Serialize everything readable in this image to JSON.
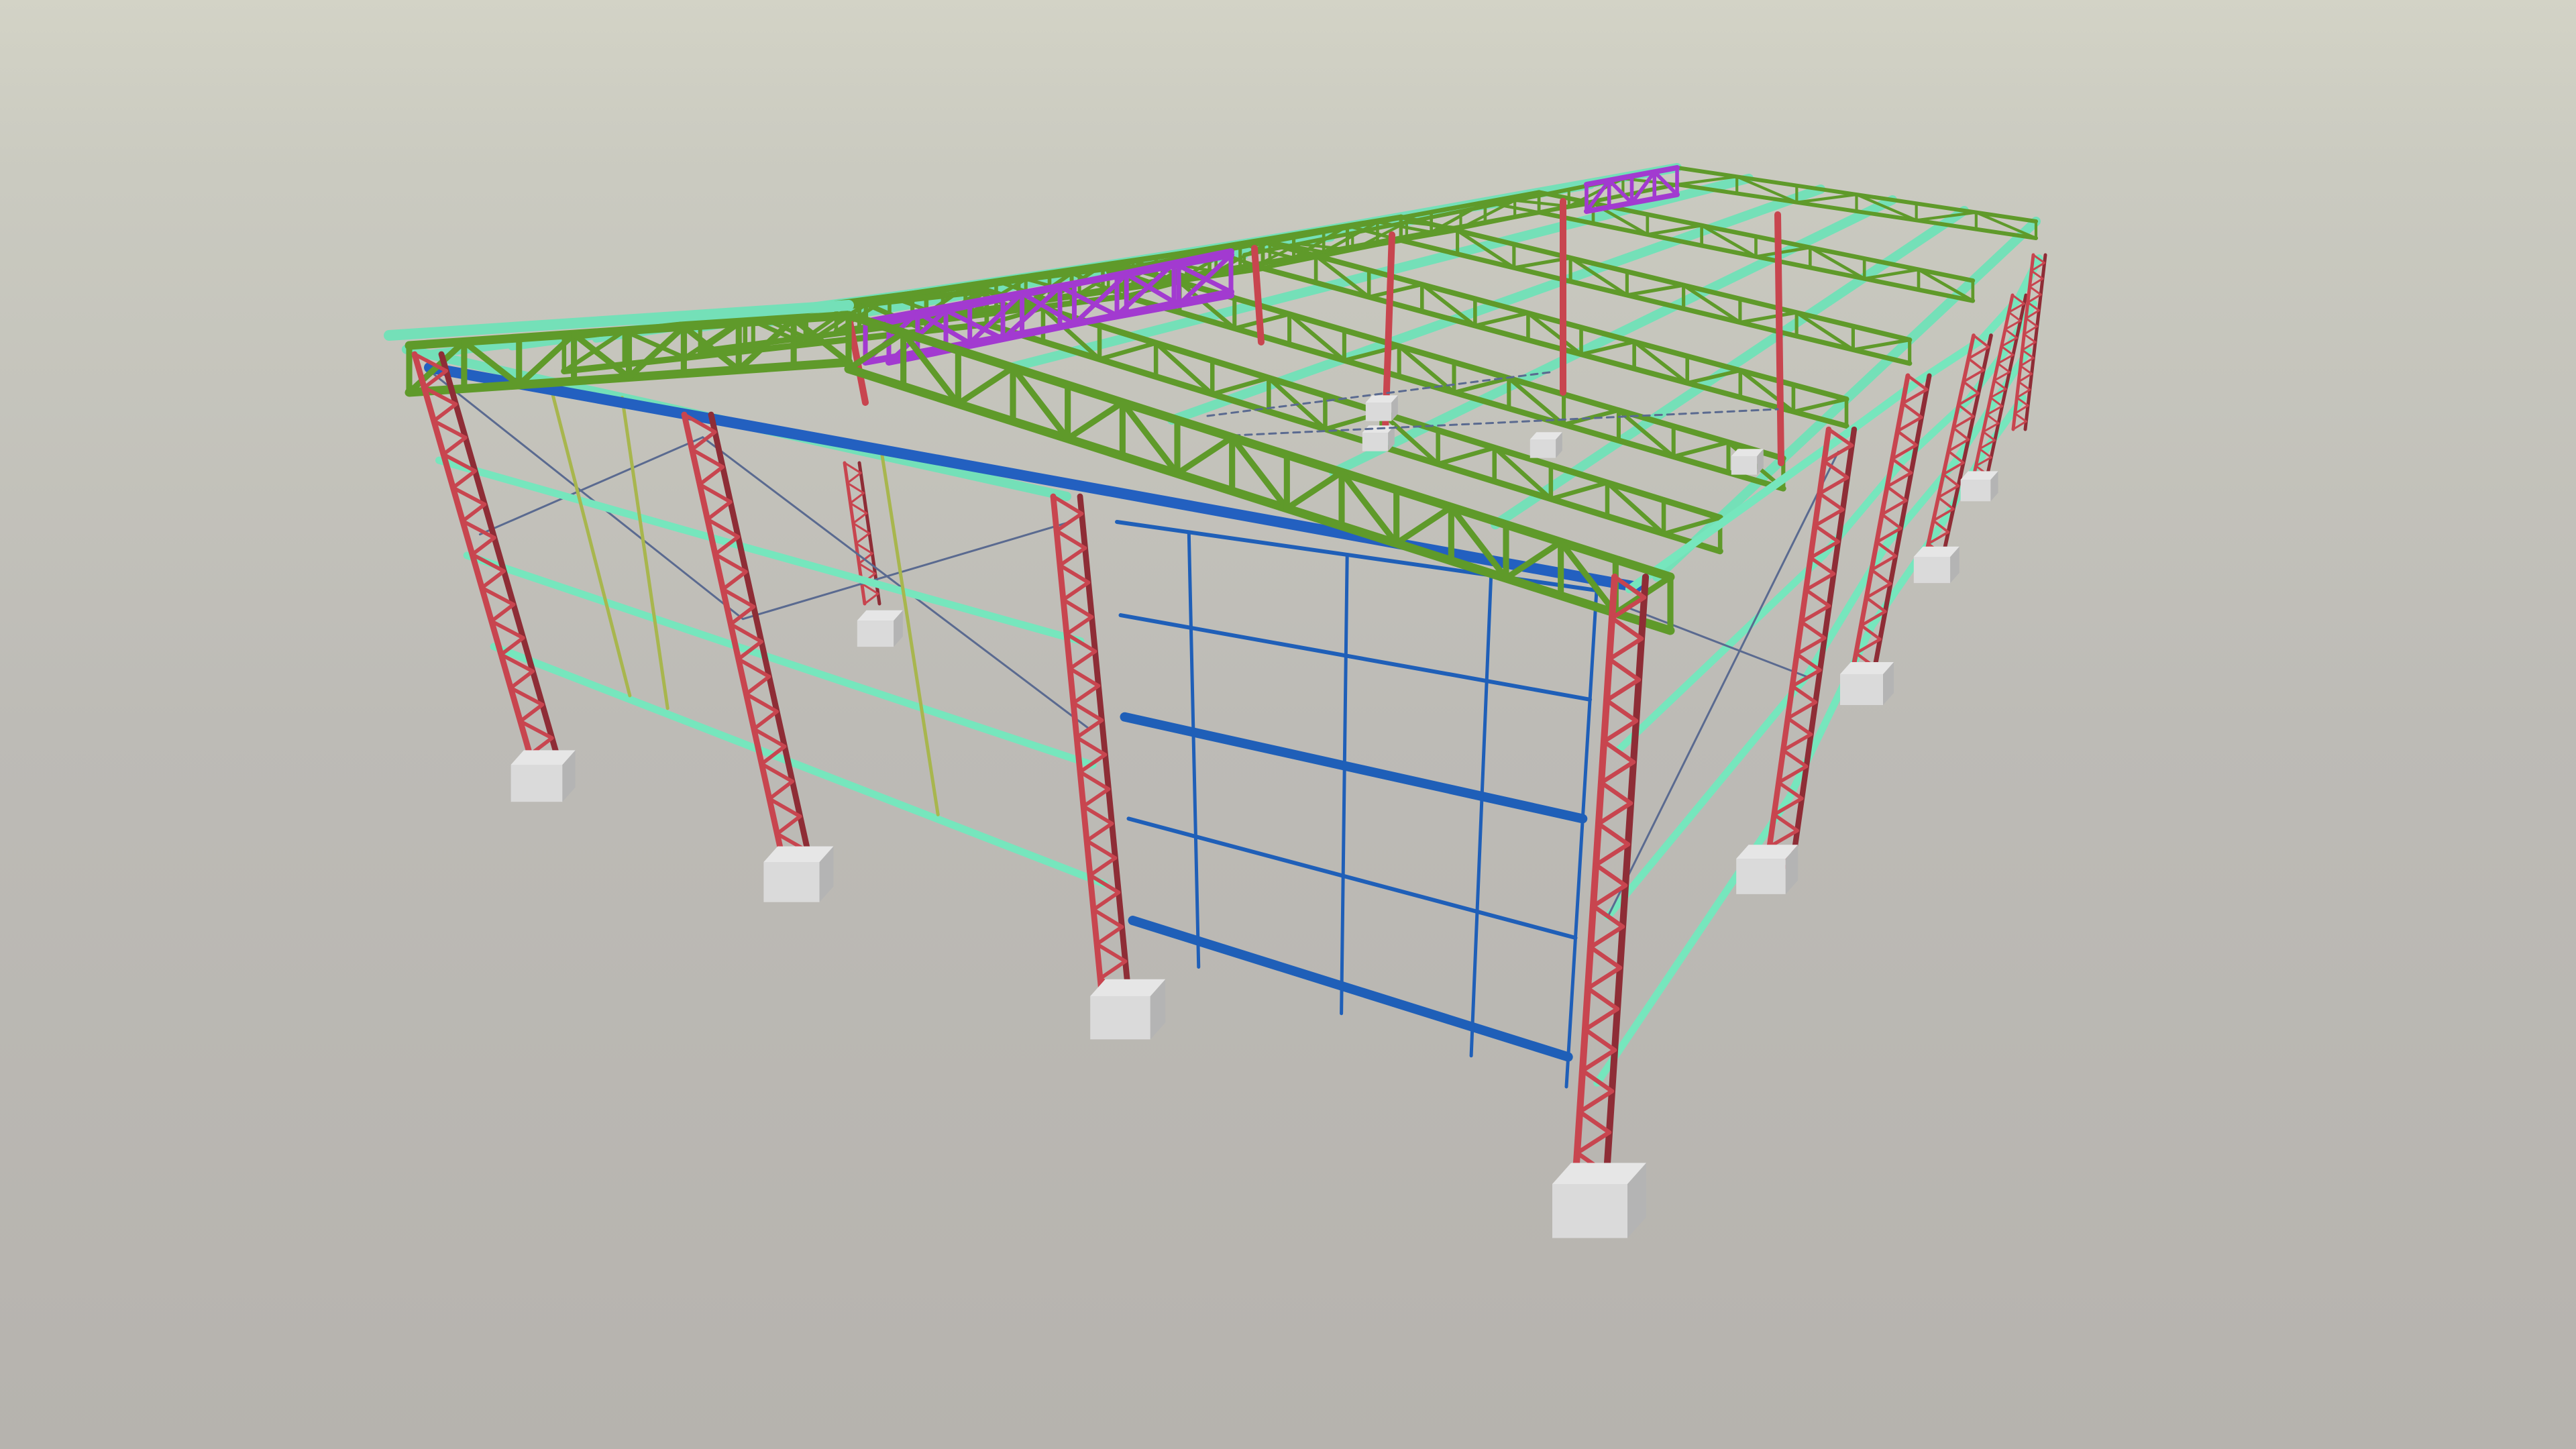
{
  "scene": {
    "subject": "steel-frame-building-3d-model",
    "background": {
      "sky": "#d0d0c4",
      "horizon": "#c6c6be",
      "ground": "#b8b5b0"
    },
    "colors": {
      "column": "#c8454f",
      "column_dark": "#8e2d36",
      "roof_truss": "#5f9a2a",
      "roof_truss_dark": "#3f6f18",
      "end_truss": "#a23ad0",
      "purlin": "#74e0b8",
      "girt": "#76e6bd",
      "end_wall_frame": "#1f5fb8",
      "eave_beam": "#2360c0",
      "wind_post": "#a8b64e",
      "bracing": "#5a6a90",
      "footing": "#dadada",
      "footing_shade": "#b4b4b4"
    },
    "counts": {
      "bays": 6,
      "frames": 7,
      "purlins_per_slope": 5,
      "wall_girts": 3
    }
  }
}
